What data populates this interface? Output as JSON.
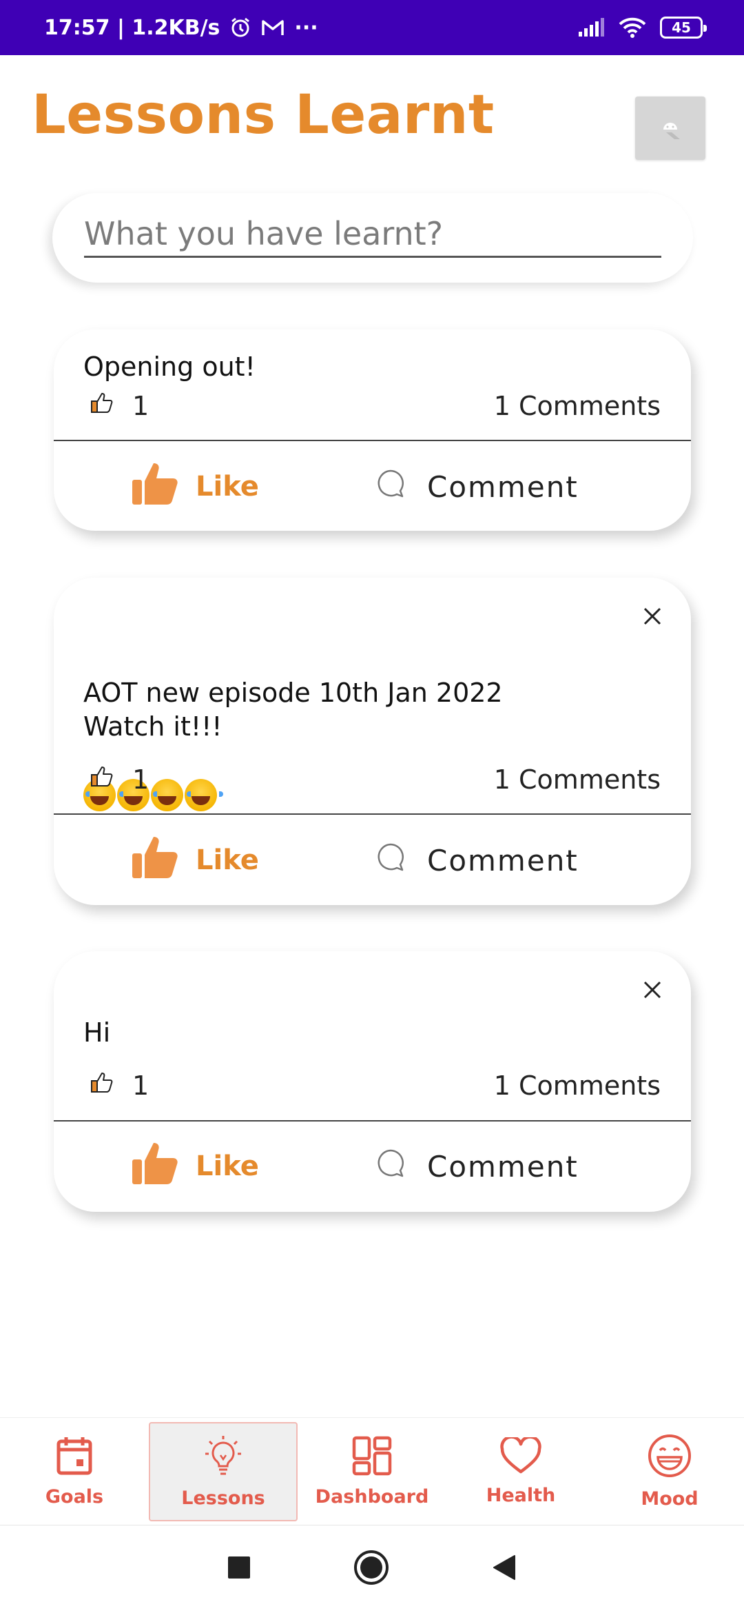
{
  "status_bar": {
    "time_speed": "17:57 | 1.2KB/s",
    "more": "···",
    "battery": "45"
  },
  "header": {
    "title": "Lessons Learnt"
  },
  "input": {
    "placeholder": "What you have learnt?",
    "value": ""
  },
  "posts": [
    {
      "text": "Opening out!",
      "likes": "1",
      "comments": "1 Comments",
      "like_label": "Like",
      "comment_label": "Comment"
    },
    {
      "text": "AOT new episode 10th Jan 2022\nWatch it!!!",
      "emojis": [
        "😂",
        "😂",
        "😂",
        "😂"
      ],
      "likes": "1",
      "comments": "1 Comments",
      "like_label": "Like",
      "comment_label": "Comment"
    },
    {
      "text": "Hi",
      "likes": "1",
      "comments": "1 Comments",
      "like_label": "Like",
      "comment_label": "Comment"
    }
  ],
  "bottom_nav": {
    "items": [
      {
        "label": "Goals",
        "icon": "calendar-icon"
      },
      {
        "label": "Lessons",
        "icon": "lightbulb-icon",
        "active": true
      },
      {
        "label": "Dashboard",
        "icon": "dashboard-grid-icon"
      },
      {
        "label": "Health",
        "icon": "heart-icon"
      },
      {
        "label": "Mood",
        "icon": "smiley-icon"
      }
    ]
  },
  "colors": {
    "accent": "#e58a2c",
    "nav_accent": "#e35b4c",
    "status_bar": "#3f00b5"
  }
}
